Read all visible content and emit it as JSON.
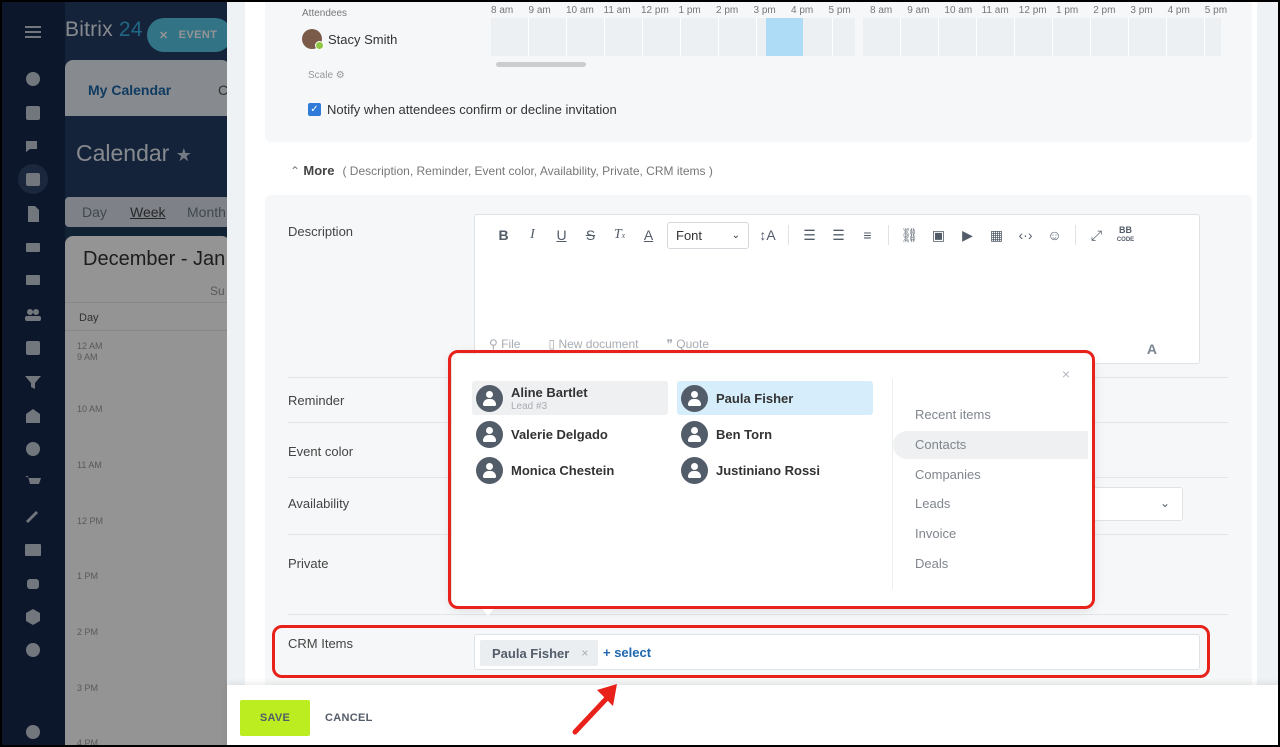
{
  "app": {
    "logo_text": "Bitrix",
    "logo_num": "24",
    "event_pill": "EVENT"
  },
  "calendar": {
    "tab_active": "My Calendar",
    "tab_other": "C",
    "title": "Calendar",
    "views": [
      "Day",
      "Week",
      "Month"
    ],
    "range": "December - Jan",
    "weekday": "Su",
    "day_label": "Day",
    "hours": [
      "12 AM",
      "9 AM",
      "10 AM",
      "11 AM",
      "12 PM",
      "1 PM",
      "2 PM",
      "3 PM",
      "4 PM"
    ]
  },
  "attendees": {
    "label": "Attendees",
    "person": "Stacy Smith",
    "scale_label": "Scale",
    "hours_a": [
      "8 am",
      "9 am",
      "10 am",
      "11 am",
      "12 pm",
      "1 pm",
      "2 pm",
      "3 pm",
      "4 pm",
      "5 pm"
    ],
    "hours_b": [
      "8 am",
      "9 am",
      "10 am",
      "11 am",
      "12 pm",
      "1 pm",
      "2 pm",
      "3 pm",
      "4 pm",
      "5 pm"
    ],
    "notify_label": "Notify when attendees confirm or decline invitation"
  },
  "more": {
    "label": "More",
    "items": "( Description,  Reminder,  Event color,  Availability,  Private,  CRM items )"
  },
  "form": {
    "description_label": "Description",
    "reminder_label": "Reminder",
    "event_color_label": "Event color",
    "availability_label": "Availability",
    "private_label": "Private",
    "crm_label": "CRM Items"
  },
  "editor": {
    "font_label": "Font",
    "footer": [
      "File",
      "New document",
      "Quote"
    ],
    "footer_a": "A",
    "bb_top": "BB",
    "bb_bottom": "CODE"
  },
  "popup": {
    "close_glyph": "×",
    "entities": [
      {
        "name": "Aline Bartlet",
        "sub": "Lead #3"
      },
      {
        "name": "Paula Fisher",
        "sub": ""
      },
      {
        "name": "Valerie Delgado",
        "sub": ""
      },
      {
        "name": "Ben Torn",
        "sub": ""
      },
      {
        "name": "Monica Chestein",
        "sub": ""
      },
      {
        "name": "Justiniano Rossi",
        "sub": ""
      }
    ],
    "categories": [
      "Recent items",
      "Contacts",
      "Companies",
      "Leads",
      "Invoice",
      "Deals"
    ],
    "active_category": "Contacts"
  },
  "crm": {
    "tag": "Paula Fisher",
    "tag_remove": "×",
    "select_link": "+ select"
  },
  "footer": {
    "save": "SAVE",
    "cancel": "CANCEL"
  },
  "colors": {
    "accent": "#2067b0",
    "save": "#bbed21",
    "highlight": "#e8221b",
    "nav": "#17294a"
  }
}
